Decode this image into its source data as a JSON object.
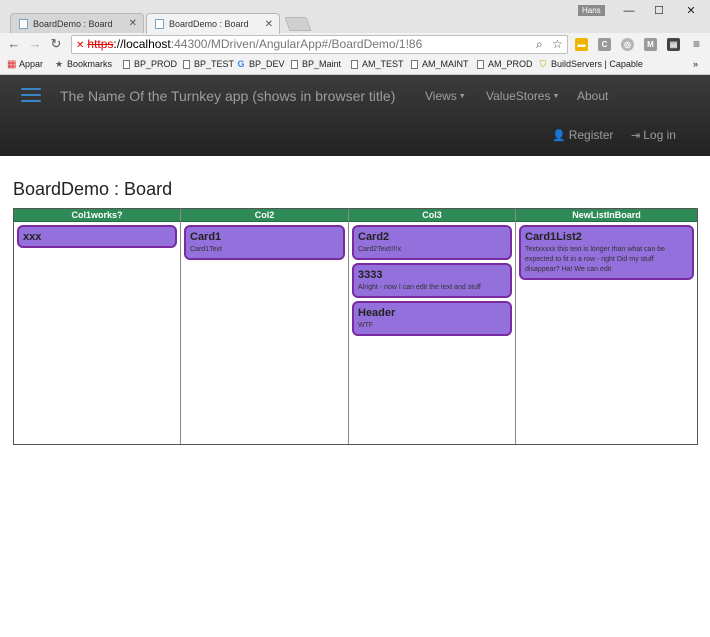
{
  "browser": {
    "tabs": [
      {
        "title": "BoardDemo : Board",
        "active": false
      },
      {
        "title": "BoardDemo : Board",
        "active": true
      }
    ],
    "user_badge": "Hans",
    "url": {
      "scheme": "https",
      "host": "://localhost",
      "path": ":44300/MDriven/AngularApp#/BoardDemo/1!86"
    },
    "bookmarks": [
      {
        "label": "Appar",
        "icon": "apps-grid-icon"
      },
      {
        "label": "Bookmarks",
        "icon": "star-icon"
      },
      {
        "label": "BP_PROD",
        "icon": "page-icon"
      },
      {
        "label": "BP_TEST",
        "icon": "page-icon"
      },
      {
        "label": "BP_DEV",
        "icon": "google-icon"
      },
      {
        "label": "BP_Maint",
        "icon": "page-icon"
      },
      {
        "label": "AM_TEST",
        "icon": "page-icon"
      },
      {
        "label": "AM_MAINT",
        "icon": "page-icon"
      },
      {
        "label": "AM_PROD",
        "icon": "page-icon"
      },
      {
        "label": "BuildServers | Capable",
        "icon": "shield-icon"
      }
    ],
    "more_bookmarks": "»"
  },
  "navbar": {
    "brand": "The Name Of the Turnkey app (shows in browser title)",
    "links": [
      "Views",
      "ValueStores",
      "About"
    ],
    "register": "Register",
    "login": "Log in"
  },
  "page": {
    "title": "BoardDemo : Board"
  },
  "board": {
    "columns": [
      {
        "header": "Col1works?",
        "cards": [
          {
            "title": "xxx",
            "text": ""
          }
        ]
      },
      {
        "header": "Col2",
        "cards": [
          {
            "title": "Card1",
            "text": "Card1Text"
          }
        ]
      },
      {
        "header": "Col3",
        "cards": [
          {
            "title": "Card2",
            "text": "Card2Text!!!!x"
          },
          {
            "title": "3333",
            "text": "Alright - now I can edit the text and stuff"
          },
          {
            "title": "Header",
            "text": "WTF"
          }
        ]
      },
      {
        "header": "NewListInBoard",
        "cards": [
          {
            "title": "Card1List2",
            "text": "Textxxxxx this text is longer than what can be expected to fit in a row - right Did my stuff disappear? Ha! We can edit"
          }
        ]
      }
    ]
  },
  "colors": {
    "column_header": "#2e8b57",
    "card_bg": "#9370db",
    "card_border": "#7a2b9f",
    "navbar_bg": "#2b2b2b"
  }
}
